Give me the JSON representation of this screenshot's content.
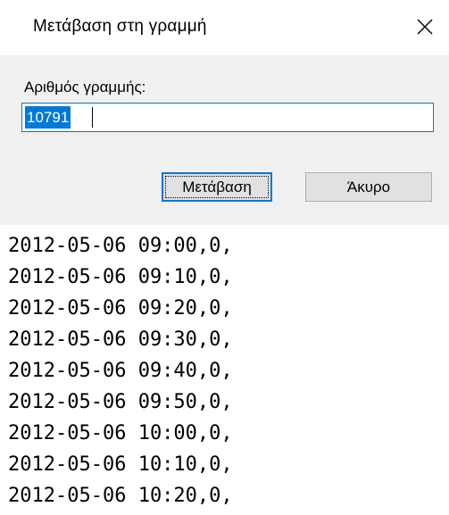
{
  "dialog": {
    "title": "Μετάβαση στη γραμμή",
    "close_icon": "close-icon",
    "line_number_label": "Αριθμός γραμμής:",
    "line_number_value": "10791",
    "go_button_label": "Μετάβαση",
    "cancel_button_label": "Άκυρο"
  },
  "editor": {
    "lines": [
      "2012-05-06 09:00,0,",
      "2012-05-06 09:10,0,",
      "2012-05-06 09:20,0,",
      "2012-05-06 09:30,0,",
      "2012-05-06 09:40,0,",
      "2012-05-06 09:50,0,",
      "2012-05-06 10:00,0,",
      "2012-05-06 10:10,0,",
      "2012-05-06 10:20,0,"
    ]
  },
  "colors": {
    "accent": "#0078d7",
    "dialog_body": "#f0f0f0",
    "button_face": "#e1e1e1"
  }
}
